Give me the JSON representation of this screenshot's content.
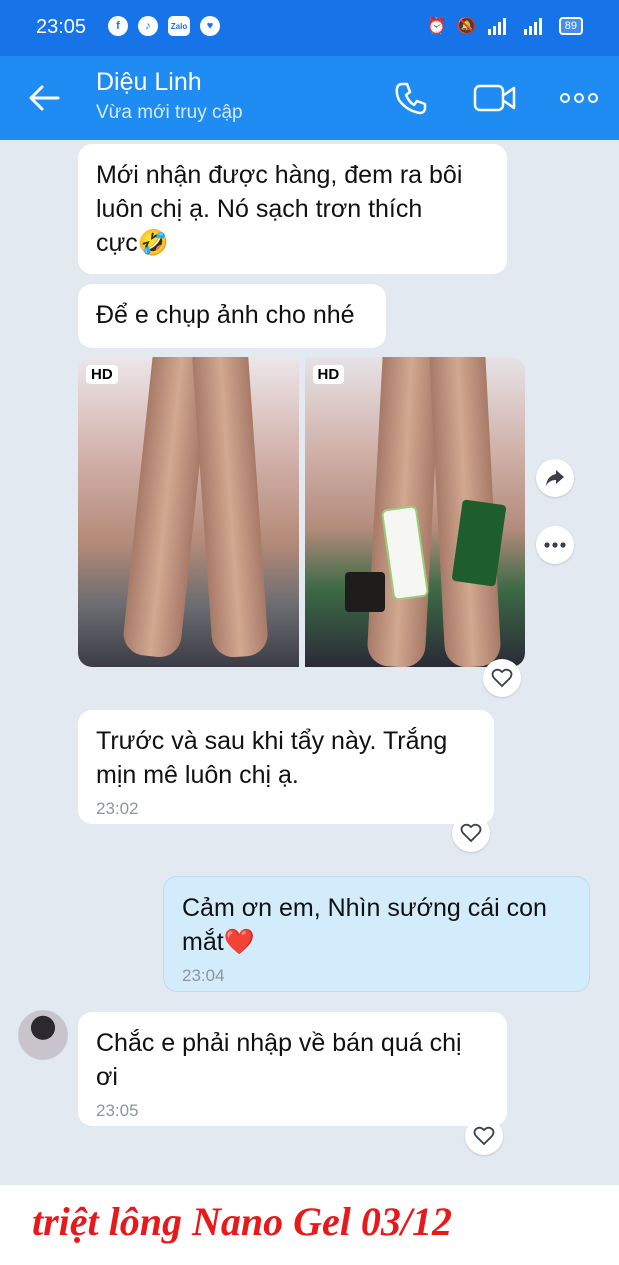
{
  "status_bar": {
    "time": "23:05",
    "battery": "89"
  },
  "header": {
    "contact_name": "Diệu Linh",
    "contact_status": "Vừa mới truy cập"
  },
  "messages": [
    {
      "direction": "incoming",
      "text": "Mới nhận được hàng, đem ra bôi\nluôn chị ạ. Nó sạch trơn thích\ncực🤣",
      "time": ""
    },
    {
      "direction": "incoming",
      "text": "Để e chụp ảnh cho nhé",
      "time": ""
    },
    {
      "direction": "incoming",
      "type": "photos",
      "badges": [
        "HD",
        "HD"
      ]
    },
    {
      "direction": "incoming",
      "text": "Trước và sau khi tẩy này. Trắng\nmịn mê luôn chị ạ.",
      "time": "23:02"
    },
    {
      "direction": "outgoing",
      "text": "Cảm ơn em, Nhìn sướng cái con\nmắt❤️",
      "time": "23:04"
    },
    {
      "direction": "incoming",
      "text": "Chắc e phải nhập về bán quá chị\nơi",
      "time": "23:05"
    }
  ],
  "caption": "triệt lông Nano Gel 03/12",
  "colors": {
    "status_bar": "#1773e8",
    "header": "#1e8cf3",
    "chat_background": "#e2e9f1",
    "outgoing_bubble": "#d3ecfb",
    "caption": "#e8181b"
  }
}
